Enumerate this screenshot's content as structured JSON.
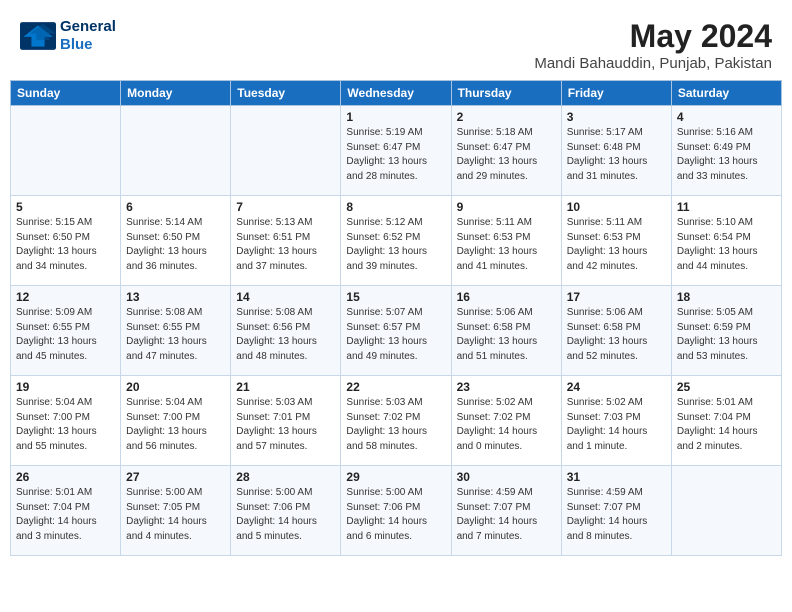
{
  "header": {
    "logo_line1": "General",
    "logo_line2": "Blue",
    "month": "May 2024",
    "location": "Mandi Bahauddin, Punjab, Pakistan"
  },
  "weekdays": [
    "Sunday",
    "Monday",
    "Tuesday",
    "Wednesday",
    "Thursday",
    "Friday",
    "Saturday"
  ],
  "weeks": [
    [
      {
        "day": "",
        "info": ""
      },
      {
        "day": "",
        "info": ""
      },
      {
        "day": "",
        "info": ""
      },
      {
        "day": "1",
        "info": "Sunrise: 5:19 AM\nSunset: 6:47 PM\nDaylight: 13 hours\nand 28 minutes."
      },
      {
        "day": "2",
        "info": "Sunrise: 5:18 AM\nSunset: 6:47 PM\nDaylight: 13 hours\nand 29 minutes."
      },
      {
        "day": "3",
        "info": "Sunrise: 5:17 AM\nSunset: 6:48 PM\nDaylight: 13 hours\nand 31 minutes."
      },
      {
        "day": "4",
        "info": "Sunrise: 5:16 AM\nSunset: 6:49 PM\nDaylight: 13 hours\nand 33 minutes."
      }
    ],
    [
      {
        "day": "5",
        "info": "Sunrise: 5:15 AM\nSunset: 6:50 PM\nDaylight: 13 hours\nand 34 minutes."
      },
      {
        "day": "6",
        "info": "Sunrise: 5:14 AM\nSunset: 6:50 PM\nDaylight: 13 hours\nand 36 minutes."
      },
      {
        "day": "7",
        "info": "Sunrise: 5:13 AM\nSunset: 6:51 PM\nDaylight: 13 hours\nand 37 minutes."
      },
      {
        "day": "8",
        "info": "Sunrise: 5:12 AM\nSunset: 6:52 PM\nDaylight: 13 hours\nand 39 minutes."
      },
      {
        "day": "9",
        "info": "Sunrise: 5:11 AM\nSunset: 6:53 PM\nDaylight: 13 hours\nand 41 minutes."
      },
      {
        "day": "10",
        "info": "Sunrise: 5:11 AM\nSunset: 6:53 PM\nDaylight: 13 hours\nand 42 minutes."
      },
      {
        "day": "11",
        "info": "Sunrise: 5:10 AM\nSunset: 6:54 PM\nDaylight: 13 hours\nand 44 minutes."
      }
    ],
    [
      {
        "day": "12",
        "info": "Sunrise: 5:09 AM\nSunset: 6:55 PM\nDaylight: 13 hours\nand 45 minutes."
      },
      {
        "day": "13",
        "info": "Sunrise: 5:08 AM\nSunset: 6:55 PM\nDaylight: 13 hours\nand 47 minutes."
      },
      {
        "day": "14",
        "info": "Sunrise: 5:08 AM\nSunset: 6:56 PM\nDaylight: 13 hours\nand 48 minutes."
      },
      {
        "day": "15",
        "info": "Sunrise: 5:07 AM\nSunset: 6:57 PM\nDaylight: 13 hours\nand 49 minutes."
      },
      {
        "day": "16",
        "info": "Sunrise: 5:06 AM\nSunset: 6:58 PM\nDaylight: 13 hours\nand 51 minutes."
      },
      {
        "day": "17",
        "info": "Sunrise: 5:06 AM\nSunset: 6:58 PM\nDaylight: 13 hours\nand 52 minutes."
      },
      {
        "day": "18",
        "info": "Sunrise: 5:05 AM\nSunset: 6:59 PM\nDaylight: 13 hours\nand 53 minutes."
      }
    ],
    [
      {
        "day": "19",
        "info": "Sunrise: 5:04 AM\nSunset: 7:00 PM\nDaylight: 13 hours\nand 55 minutes."
      },
      {
        "day": "20",
        "info": "Sunrise: 5:04 AM\nSunset: 7:00 PM\nDaylight: 13 hours\nand 56 minutes."
      },
      {
        "day": "21",
        "info": "Sunrise: 5:03 AM\nSunset: 7:01 PM\nDaylight: 13 hours\nand 57 minutes."
      },
      {
        "day": "22",
        "info": "Sunrise: 5:03 AM\nSunset: 7:02 PM\nDaylight: 13 hours\nand 58 minutes."
      },
      {
        "day": "23",
        "info": "Sunrise: 5:02 AM\nSunset: 7:02 PM\nDaylight: 14 hours\nand 0 minutes."
      },
      {
        "day": "24",
        "info": "Sunrise: 5:02 AM\nSunset: 7:03 PM\nDaylight: 14 hours\nand 1 minute."
      },
      {
        "day": "25",
        "info": "Sunrise: 5:01 AM\nSunset: 7:04 PM\nDaylight: 14 hours\nand 2 minutes."
      }
    ],
    [
      {
        "day": "26",
        "info": "Sunrise: 5:01 AM\nSunset: 7:04 PM\nDaylight: 14 hours\nand 3 minutes."
      },
      {
        "day": "27",
        "info": "Sunrise: 5:00 AM\nSunset: 7:05 PM\nDaylight: 14 hours\nand 4 minutes."
      },
      {
        "day": "28",
        "info": "Sunrise: 5:00 AM\nSunset: 7:06 PM\nDaylight: 14 hours\nand 5 minutes."
      },
      {
        "day": "29",
        "info": "Sunrise: 5:00 AM\nSunset: 7:06 PM\nDaylight: 14 hours\nand 6 minutes."
      },
      {
        "day": "30",
        "info": "Sunrise: 4:59 AM\nSunset: 7:07 PM\nDaylight: 14 hours\nand 7 minutes."
      },
      {
        "day": "31",
        "info": "Sunrise: 4:59 AM\nSunset: 7:07 PM\nDaylight: 14 hours\nand 8 minutes."
      },
      {
        "day": "",
        "info": ""
      }
    ]
  ]
}
